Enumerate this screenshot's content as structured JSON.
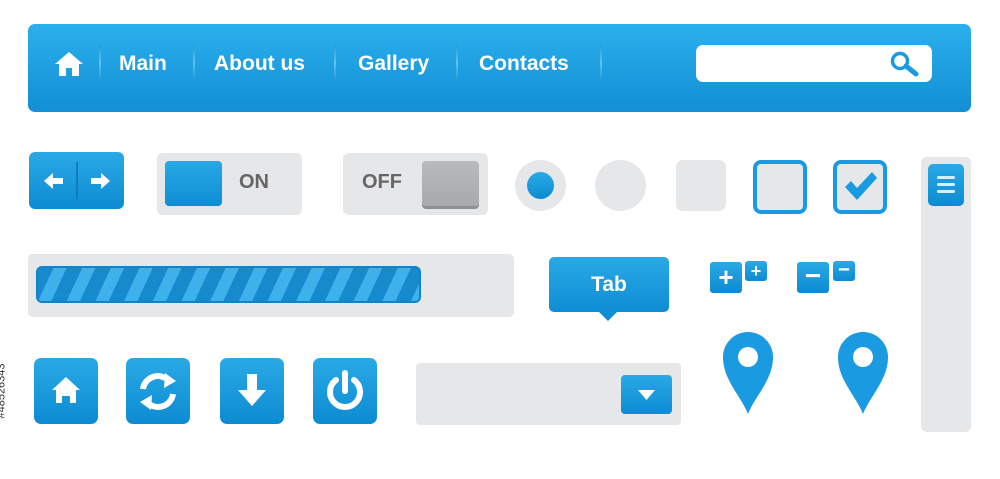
{
  "navbar": {
    "home_icon": "home-icon",
    "items": [
      {
        "label": "Main"
      },
      {
        "label": "About us"
      },
      {
        "label": "Gallery"
      },
      {
        "label": "Contacts"
      }
    ],
    "search": {
      "placeholder": "",
      "icon": "search-icon"
    }
  },
  "toggles": {
    "on_label": "ON",
    "off_label": "OFF"
  },
  "radio": {
    "selected": true
  },
  "checkbox": {
    "checked": true
  },
  "progress": {
    "value_fraction": 0.82
  },
  "tab": {
    "label": "Tab"
  },
  "zoom": {
    "plus": "+",
    "minus": "−"
  },
  "icon_buttons": [
    "home-icon",
    "refresh-icon",
    "download-arrow-icon",
    "power-icon"
  ],
  "colors": {
    "accent": "#1a9ae0",
    "control_bg": "#e6e7e9",
    "dark_blue": "#0d8bd2"
  },
  "side_code": "#48526343"
}
